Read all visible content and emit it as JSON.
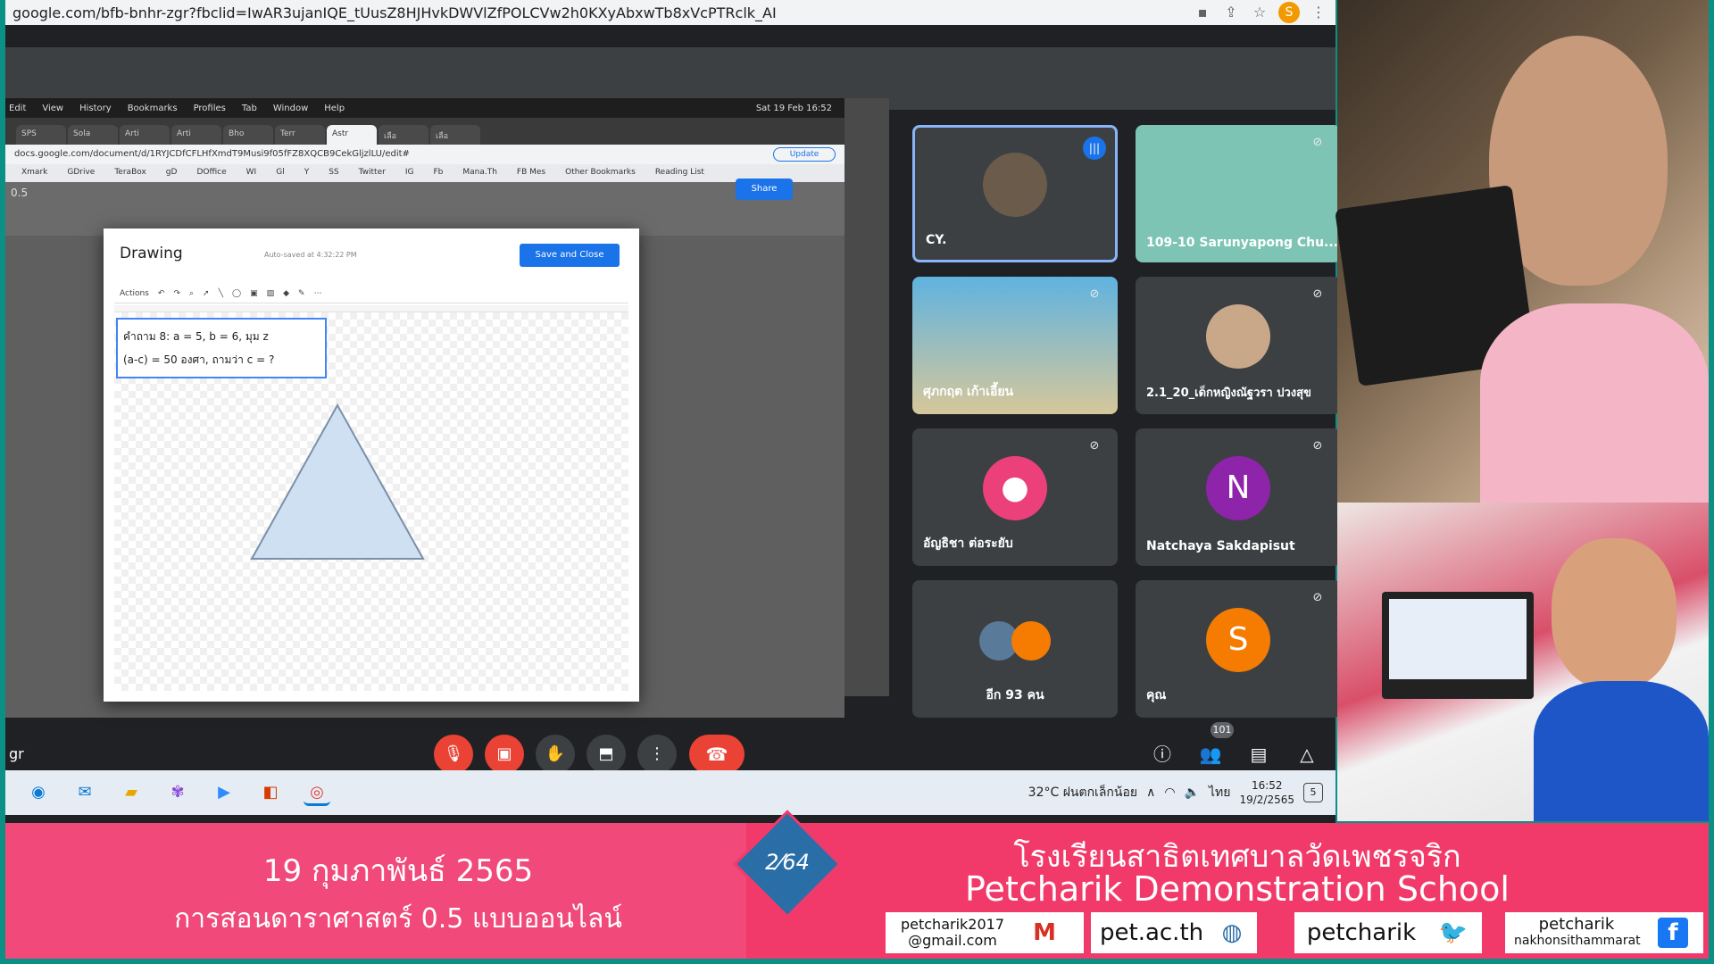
{
  "browser": {
    "url": "google.com/bfb-bnhr-zgr?fbclid=IwAR3ujanIQE_tUusZ8HJHvkDWVlZfPOLCVw2h0KXyAbxwTb8xVcPTRclk_AI",
    "profile_initial": "S"
  },
  "mac_menu": {
    "items": [
      "Edit",
      "View",
      "History",
      "Bookmarks",
      "Profiles",
      "Tab",
      "Window",
      "Help"
    ],
    "clock": "Sat 19 Feb 16:52"
  },
  "inner_tabs": [
    "SPS",
    "Sola",
    "Arti",
    "Arti",
    "Bho",
    "Terr",
    "Astr",
    "เลือ",
    "เลือ"
  ],
  "inner_address": "docs.google.com/document/d/1RYJCDfCFLHfXmdT9Musi9f05fFZ8XQCB9CekGljzlLU/edit#",
  "update_label": "Update",
  "bookmarks": [
    "Xmark",
    "GDrive",
    "TeraBox",
    "gD",
    "DOffice",
    "WI",
    "Gl",
    "Y",
    "SS",
    "Twitter",
    "IG",
    "Fb",
    "Mana.Th",
    "FB Mes",
    "Other Bookmarks",
    "Reading List"
  ],
  "docs": {
    "version": "0.5",
    "share_label": "Share"
  },
  "drawing": {
    "title": "Drawing",
    "autosaved": "Auto-saved at 4:32:22 PM",
    "save_close": "Save and Close",
    "actions_label": "Actions",
    "question_line1": "คำถาม 8:    a = 5, b = 6, มุม z",
    "question_line2": "(a-c) = 50 องศา, ถามว่า c = ?",
    "triangle_fill": "#cfe0f3"
  },
  "participants": [
    {
      "name": "CY.",
      "speaking": true
    },
    {
      "name": "109-10 Sarunyapong Chu..."
    },
    {
      "name": "ศุภกฤต เก้าเอี้ยน"
    },
    {
      "name": "2.1_20_เด็กหญิงณัฐวรา ปวงสุข"
    },
    {
      "name": "อัญธิชา ต่อระยับ",
      "avatar_color": "#ec407a"
    },
    {
      "name": "Natchaya Sakdapisut",
      "initial": "N",
      "avatar_color": "#8e24aa"
    },
    {
      "name": "อีก 93 คน"
    },
    {
      "name": "คุณ",
      "initial": "S",
      "avatar_color": "#f57c00"
    }
  ],
  "meeting": {
    "code_fragment": "gr",
    "people_count": "101"
  },
  "taskbar": {
    "weather": "32°C  ฝนตกเล็กน้อย",
    "lang": "ไทย",
    "time": "16:52",
    "date": "19/2/2565",
    "notifications": "5"
  },
  "banner": {
    "date": "19 กุมภาพันธ์ 2565",
    "course": "การสอนดาราศาสตร์ 0.5 แบบออนไลน์",
    "page_num": "2",
    "page_total": "64",
    "school_th": "โรงเรียนสาธิตเทศบาลวัดเพชรจริก",
    "school_en": "Petcharik Demonstration School",
    "email_line1": "petcharik2017",
    "email_line2": "@gmail.com",
    "website": "pet.ac.th",
    "twitter": "petcharik",
    "facebook_line1": "petcharik",
    "facebook_line2": "nakhonsithammarat",
    "accent": "#f13a6a"
  }
}
